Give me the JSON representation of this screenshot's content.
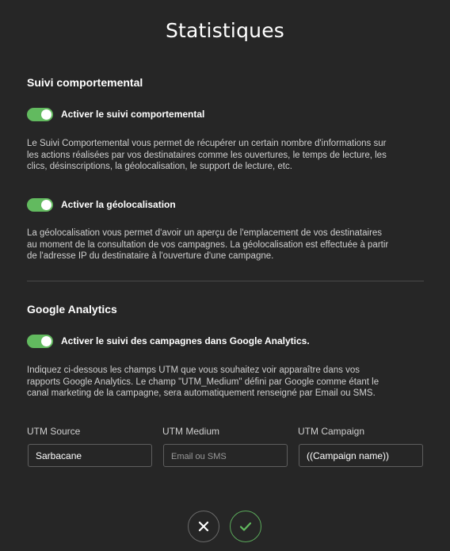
{
  "title": "Statistiques",
  "behavioral": {
    "heading": "Suivi comportemental",
    "toggle_tracking": {
      "label": "Activer le suivi comportemental",
      "on": true
    },
    "tracking_desc_lines": [
      "Le Suivi Comportemental vous permet de récupérer un certain nombre d'informations sur",
      "les actions réalisées par vos destinataires comme les ouvertures, le temps de lecture, les",
      "clics, désinscriptions, la géolocalisation, le support de lecture, etc."
    ],
    "toggle_geo": {
      "label": "Activer la géolocalisation",
      "on": true
    },
    "geo_desc_lines": [
      "La géolocalisation vous permet d'avoir un aperçu de l'emplacement de vos destinataires",
      "au moment de la consultation de vos campagnes. La géolocalisation est effectuée à partir",
      "de l'adresse IP du destinataire à l'ouverture d'une campagne."
    ]
  },
  "analytics": {
    "heading": "Google Analytics",
    "toggle_campaign": {
      "label": "Activer le suivi des campagnes dans Google Analytics.",
      "on": true
    },
    "desc_lines": [
      "Indiquez ci-dessous les champs UTM que vous souhaitez voir apparaître dans vos",
      "rapports Google Analytics. Le champ \"UTM_Medium\" défini par Google comme étant le",
      "canal marketing de la campagne, sera automatiquement renseigné par Email ou SMS."
    ],
    "utm_source": {
      "label": "UTM Source",
      "value": "Sarbacane",
      "placeholder": ""
    },
    "utm_medium": {
      "label": "UTM Medium",
      "value": "",
      "placeholder": "Email ou SMS"
    },
    "utm_campaign": {
      "label": "UTM Campaign",
      "value": "((Campaign name))",
      "placeholder": ""
    }
  },
  "actions": {
    "cancel_icon": "close-icon",
    "confirm_icon": "check-icon"
  },
  "colors": {
    "background": "#262626",
    "toggle_on": "#62ba5f",
    "confirm_accent": "#5aa85a"
  }
}
